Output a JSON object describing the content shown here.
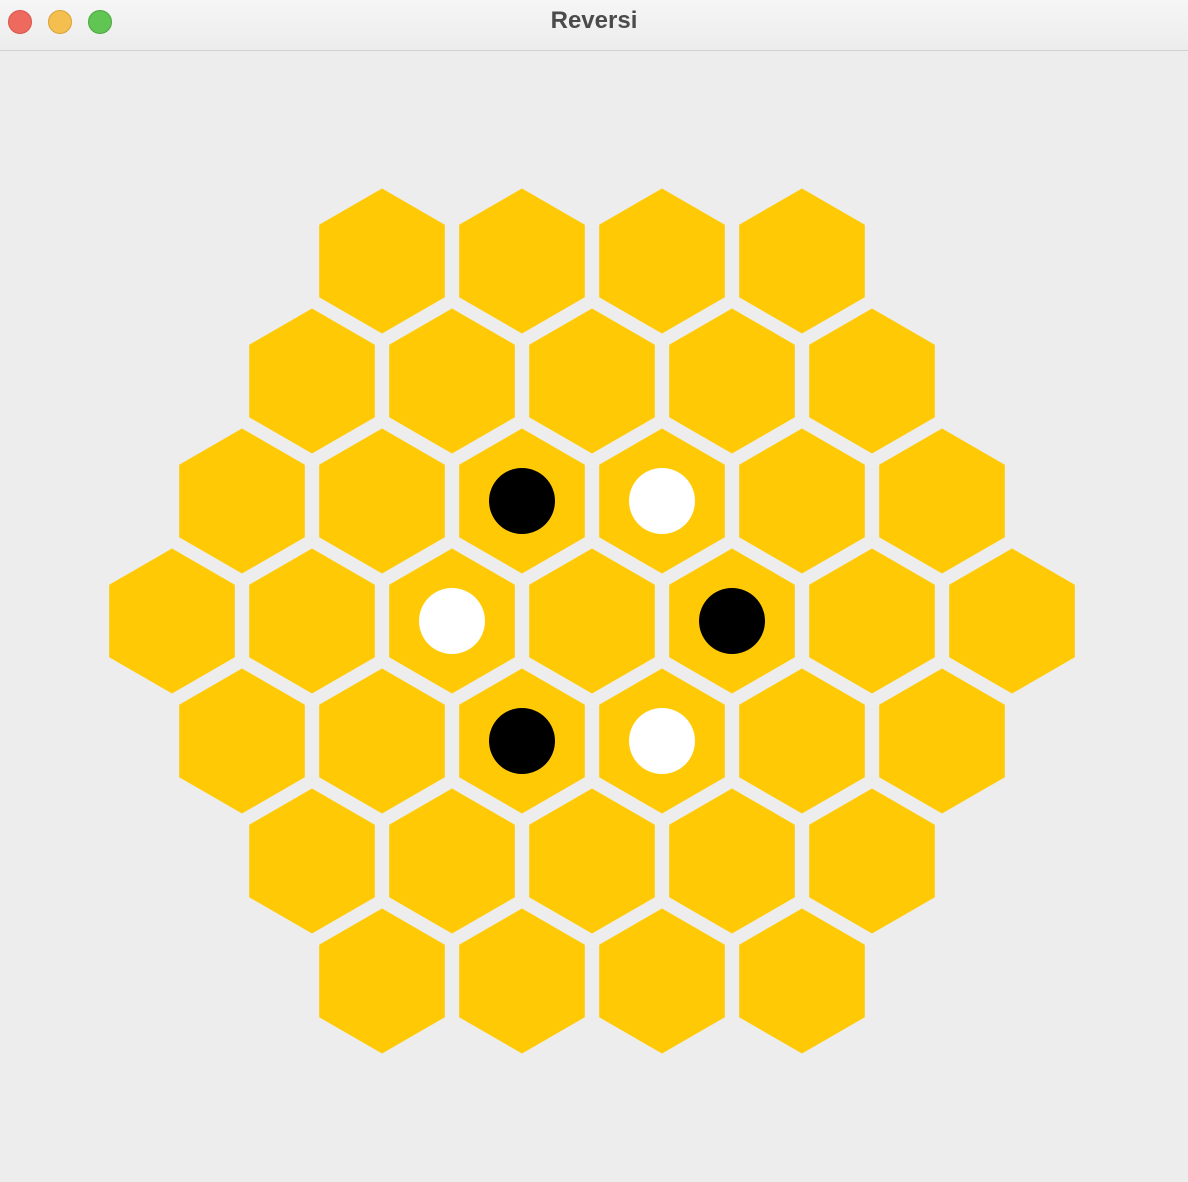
{
  "window": {
    "title": "Reversi",
    "controls": [
      "close-button",
      "minimize-button",
      "maximize-button"
    ]
  },
  "colors": {
    "board_background": "#ededed",
    "hex_fill": "#ffca05",
    "cell_gap": "#ededed",
    "black_piece": "#000000",
    "white_piece": "#ffffff",
    "close": "#ee6a5f",
    "minimize": "#f5bf4f",
    "maximize": "#61c554"
  },
  "board": {
    "shape": "hexagon",
    "rows": [
      4,
      5,
      6,
      7,
      6,
      5,
      4
    ],
    "pieces": [
      {
        "row": 2,
        "col": 2,
        "color": "black"
      },
      {
        "row": 2,
        "col": 3,
        "color": "white"
      },
      {
        "row": 3,
        "col": 2,
        "color": "white"
      },
      {
        "row": 3,
        "col": 4,
        "color": "black"
      },
      {
        "row": 4,
        "col": 2,
        "color": "black"
      },
      {
        "row": 4,
        "col": 3,
        "color": "white"
      }
    ]
  }
}
